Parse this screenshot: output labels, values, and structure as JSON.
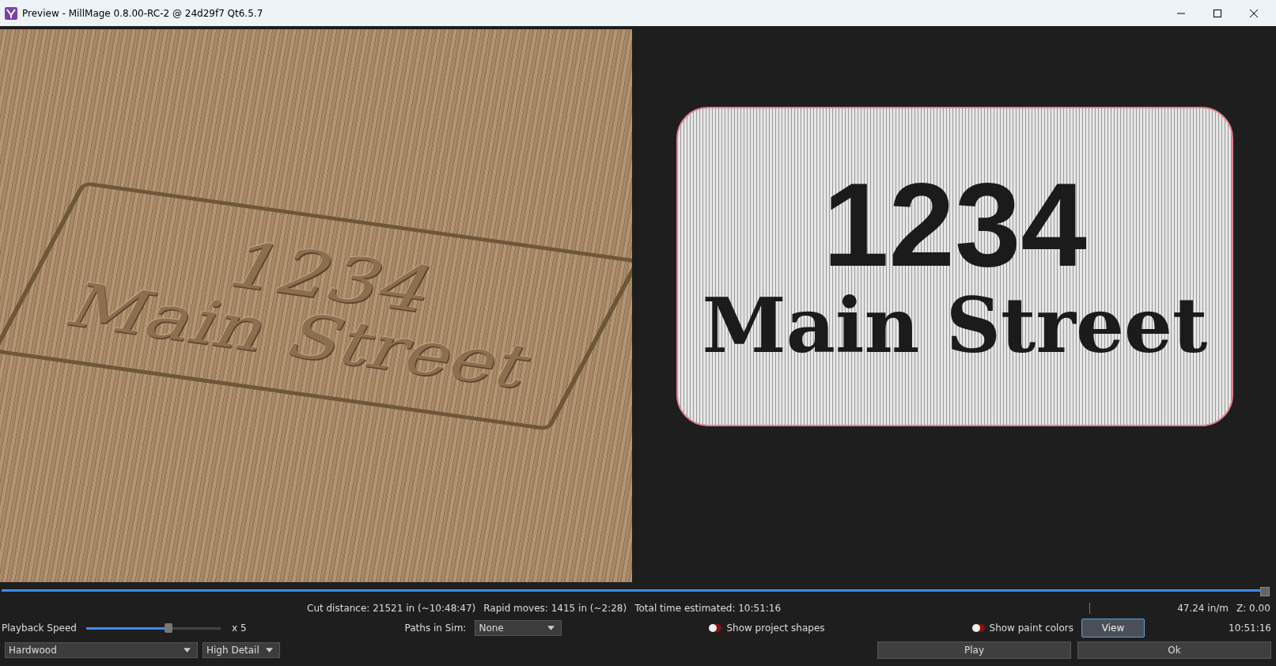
{
  "window": {
    "title": "Preview - MillMage 0.8.00-RC-2 @ 24d29f7 Qt6.5.7"
  },
  "render_view": {
    "lines": [
      "1234",
      "Main Street"
    ]
  },
  "toolpath_view": {
    "lines": [
      "1234",
      "Main Street"
    ]
  },
  "progress": {
    "level": 1
  },
  "stats": {
    "cut": "Cut distance: 21521 in (~10:48:47)",
    "rapid": "Rapid moves: 1415 in (~2:28)",
    "total": "Total time estimated: 10:51:16",
    "feed": "47.24 in/m",
    "z": "Z: 0.00"
  },
  "playback": {
    "label": "Playback Speed",
    "level": 0.61,
    "reading": "x 5"
  },
  "paths_in_sim": {
    "label": "Paths in Sim:",
    "value": "None"
  },
  "toggles": [
    {
      "label": "Show project shapes",
      "on": false
    },
    {
      "label": "Show paint colors",
      "on": false
    }
  ],
  "view_button": "View",
  "time": "10:51:16",
  "material": {
    "value": "Hardwood"
  },
  "detail": {
    "value": "High Detail"
  },
  "buttons": [
    "Play",
    "Ok"
  ]
}
